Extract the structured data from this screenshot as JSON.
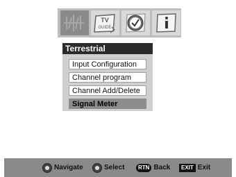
{
  "tabs": [
    {
      "icon": "antenna-icon",
      "active": true
    },
    {
      "icon": "tv-guide-icon",
      "text": "TV GUIDE",
      "active": false
    },
    {
      "icon": "clock-icon",
      "active": false
    },
    {
      "icon": "info-icon",
      "active": false
    }
  ],
  "menu": {
    "title": "Terrestrial",
    "items": [
      {
        "label": "Input Configuration",
        "selected": false
      },
      {
        "label": "Channel program",
        "selected": false
      },
      {
        "label": "Channel Add/Delete",
        "selected": false
      },
      {
        "label": "Signal Meter",
        "selected": true
      }
    ]
  },
  "footer": {
    "navigate_label": "Navigate",
    "select_label": "Select",
    "rtn_key": "RTN",
    "back_label": "Back",
    "exit_key": "EXIT",
    "exit_label": "Exit"
  }
}
